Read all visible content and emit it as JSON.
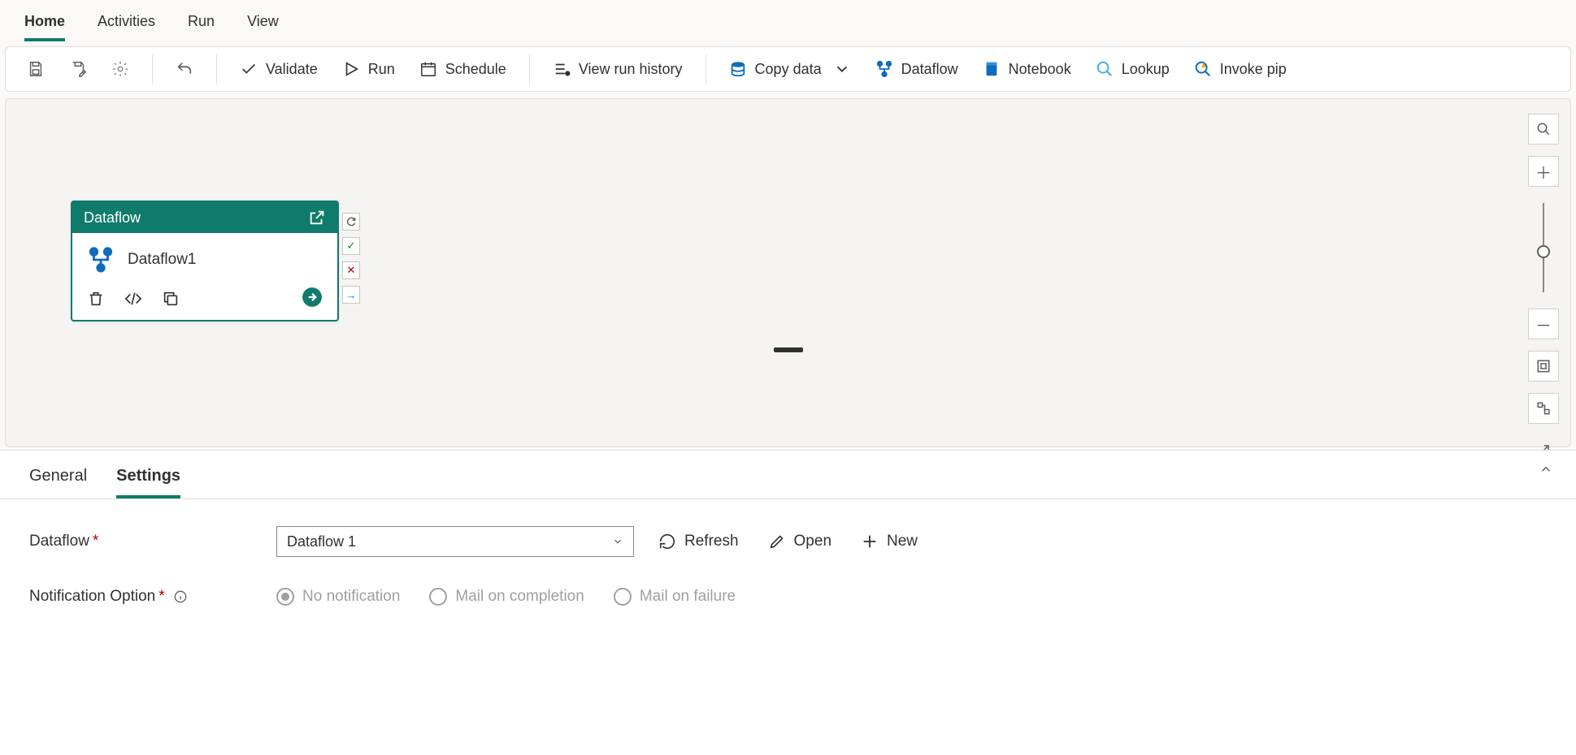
{
  "topTabs": {
    "home": "Home",
    "activities": "Activities",
    "run": "Run",
    "view": "View"
  },
  "toolbar": {
    "validate": "Validate",
    "run": "Run",
    "schedule": "Schedule",
    "viewRunHistory": "View run history",
    "copyData": "Copy data",
    "dataflow": "Dataflow",
    "notebook": "Notebook",
    "lookup": "Lookup",
    "invokePipeline": "Invoke pip"
  },
  "activity": {
    "headerTitle": "Dataflow",
    "name": "Dataflow1"
  },
  "bottom": {
    "tabs": {
      "general": "General",
      "settings": "Settings"
    },
    "dataflowLabel": "Dataflow",
    "dataflowSelected": "Dataflow 1",
    "refresh": "Refresh",
    "open": "Open",
    "new": "New",
    "notificationLabel": "Notification Option",
    "radios": {
      "none": "No notification",
      "complete": "Mail on completion",
      "failure": "Mail on failure"
    }
  }
}
